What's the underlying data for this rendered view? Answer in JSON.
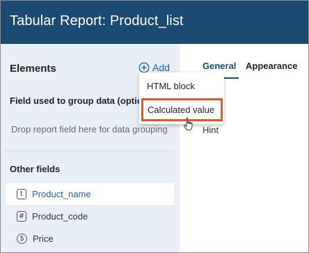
{
  "window": {
    "title": "Tabular Report: Product_list"
  },
  "elements_panel": {
    "heading": "Elements",
    "add_label": "Add",
    "group_heading": "Field used to group data (optional)",
    "drop_hint": "Drop report field here for data grouping",
    "other_heading": "Other fields",
    "fields": [
      {
        "label": "Product_name",
        "type_symbol": "t",
        "icon": "text-field-icon",
        "selected": true
      },
      {
        "label": "Product_code",
        "type_symbol": "#",
        "icon": "number-field-icon",
        "selected": false
      },
      {
        "label": "Price",
        "type_symbol": "$",
        "icon": "currency-field-icon",
        "selected": false
      }
    ]
  },
  "tabs": {
    "general": "General",
    "appearance": "Appearance",
    "active": "General"
  },
  "properties": {
    "hint_label": "Hint"
  },
  "add_menu": {
    "items": [
      {
        "label": "HTML block"
      },
      {
        "label": "Calculated value",
        "highlighted": true
      }
    ]
  },
  "colors": {
    "title_bar": "#1b4b73",
    "accent": "#1b5fa8",
    "highlight_border": "#e05a20",
    "panel_bg": "#e9eff6"
  }
}
